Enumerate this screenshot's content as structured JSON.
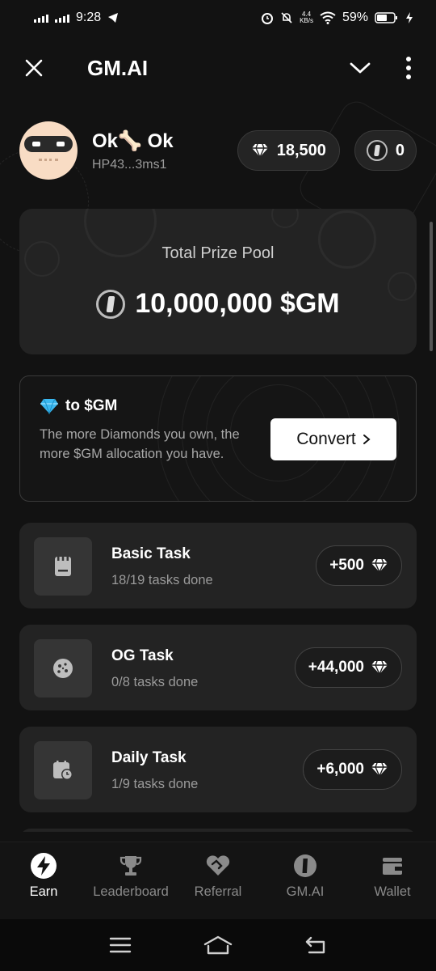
{
  "status_bar": {
    "time": "9:28",
    "net_speed_value": "4.4",
    "net_speed_unit": "KB/s",
    "battery": "59%"
  },
  "header": {
    "title": "GM.AI"
  },
  "profile": {
    "name": "Ok🦴 Ok",
    "wallet": "HP43...3ms1",
    "diamonds": "18,500",
    "gm_balance": "0"
  },
  "prize_pool": {
    "label": "Total Prize Pool",
    "amount": "10,000,000 $GM"
  },
  "convert_card": {
    "title": "to $GM",
    "description": "The more Diamonds you own, the more $GM allocation you have.",
    "button_label": "Convert"
  },
  "tasks": [
    {
      "title": "Basic Task",
      "progress": "18/19 tasks done",
      "reward": "+500",
      "icon": "receipt-icon"
    },
    {
      "title": "OG Task",
      "progress": "0/8 tasks done",
      "reward": "+44,000",
      "icon": "cookie-icon"
    },
    {
      "title": "Daily Task",
      "progress": "1/9 tasks done",
      "reward": "+6,000",
      "icon": "calendar-clock-icon"
    }
  ],
  "bottom_nav": {
    "items": [
      {
        "label": "Earn",
        "icon": "bolt-icon",
        "active": true
      },
      {
        "label": "Leaderboard",
        "icon": "trophy-icon",
        "active": false
      },
      {
        "label": "Referral",
        "icon": "handshake-icon",
        "active": false
      },
      {
        "label": "GM.AI",
        "icon": "gm-coin-icon",
        "active": false
      },
      {
        "label": "Wallet",
        "icon": "wallet-icon",
        "active": false
      }
    ]
  },
  "colors": {
    "background": "#121212",
    "card": "#232323",
    "accent_text": "#ffffff",
    "muted_text": "#9a9a9a",
    "diamond": "#3bb8f0"
  }
}
